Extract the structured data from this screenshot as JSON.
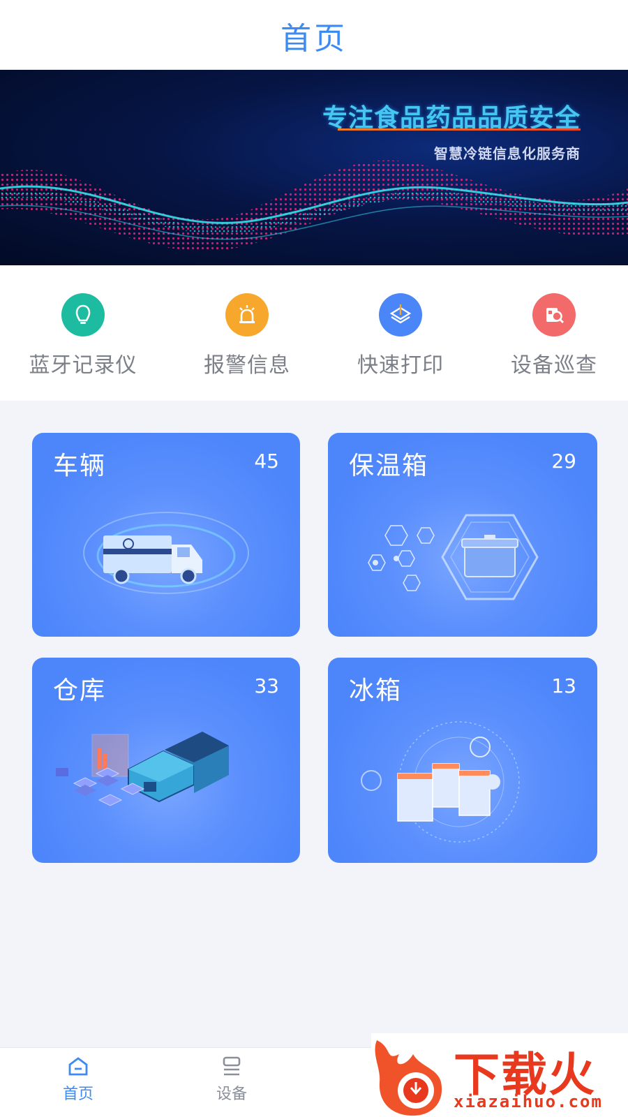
{
  "header": {
    "title": "首页"
  },
  "banner": {
    "title": "专注食品药品品质安全",
    "subtitle": "智慧冷链信息化服务商"
  },
  "quick_actions": [
    {
      "label": "蓝牙记录仪",
      "icon": "bluetooth-recorder-icon",
      "color": "#1dbba0"
    },
    {
      "label": "报警信息",
      "icon": "alarm-light-icon",
      "color": "#f7a72b"
    },
    {
      "label": "快速打印",
      "icon": "print-layers-icon",
      "color": "#4a86f7"
    },
    {
      "label": "设备巡查",
      "icon": "inspection-search-icon",
      "color": "#f26a6a"
    }
  ],
  "cards": [
    {
      "title": "车辆",
      "count": "45",
      "illustration": "truck-illustration"
    },
    {
      "title": "保温箱",
      "count": "29",
      "illustration": "cooler-box-illustration"
    },
    {
      "title": "仓库",
      "count": "33",
      "illustration": "warehouse-illustration"
    },
    {
      "title": "冰箱",
      "count": "13",
      "illustration": "refrigerator-illustration"
    }
  ],
  "tabbar": {
    "items": [
      {
        "label": "首页",
        "icon": "home-icon",
        "active": true
      },
      {
        "label": "设备",
        "icon": "device-icon",
        "active": false
      }
    ],
    "active_color": "#3d8bf2",
    "inactive_color": "#8a8f99"
  },
  "watermark": {
    "text": "下载火",
    "url": "xiazaihuo.com"
  }
}
